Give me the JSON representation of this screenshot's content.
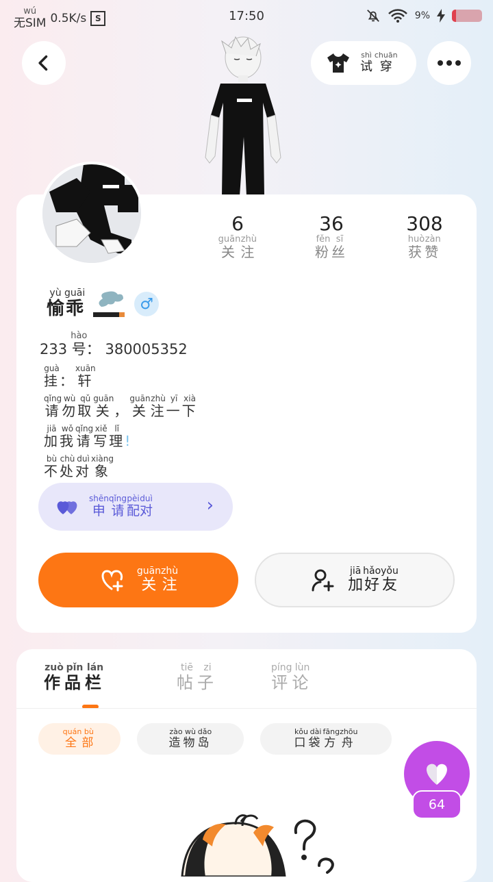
{
  "status_bar": {
    "no_sim": "无SIM",
    "no_sim_ruby": "wú",
    "speed": "0.5K/s",
    "s_badge": "S",
    "time": "17:50",
    "battery": "9%"
  },
  "top": {
    "back_icon": "chevron-left-icon",
    "try_on": {
      "label_1": "试",
      "ruby_1": "shì",
      "label_2": "穿",
      "ruby_2": "chuān",
      "icon": "shirt-sparkle-icon"
    },
    "more_icon": "more-dots-icon"
  },
  "stats": [
    {
      "value": "6",
      "label": [
        "关",
        "注"
      ],
      "ruby": [
        "guān",
        "zhù"
      ]
    },
    {
      "value": "36",
      "label": [
        "粉",
        "丝"
      ],
      "ruby": [
        "fěn",
        "sī"
      ]
    },
    {
      "value": "308",
      "label": [
        "获",
        "赞"
      ],
      "ruby": [
        "huò",
        "zàn"
      ]
    }
  ],
  "profile": {
    "name": [
      "愉",
      "乖"
    ],
    "name_ruby": [
      "yù",
      "guāi"
    ],
    "gender_symbol": "♂",
    "id_prefix": "233",
    "id_hao": "号",
    "id_hao_ruby": "hào",
    "id_sep": "：",
    "id_number": "380005352",
    "bio": [
      {
        "chars": [
          "挂",
          "：",
          "轩"
        ],
        "ruby": [
          "guà",
          "",
          "xuān"
        ]
      },
      {
        "chars": [
          "请",
          "勿",
          "取",
          "关",
          "，",
          "关",
          "注",
          "一",
          "下"
        ],
        "ruby": [
          "qǐng",
          "wù",
          "qǔ",
          "guān",
          "",
          "guān",
          "zhù",
          "yī",
          "xià"
        ]
      },
      {
        "chars": [
          "加",
          "我",
          "请",
          "写",
          "理",
          "!"
        ],
        "ruby": [
          "jiā",
          "wǒ",
          "qǐng",
          "xiě",
          "lǐ",
          ""
        ]
      },
      {
        "chars": [
          "不",
          "处",
          "对",
          "象"
        ],
        "ruby": [
          "bù",
          "chù",
          "duì",
          "xiàng"
        ]
      }
    ]
  },
  "pair_button": {
    "chars": [
      "申",
      "请",
      "配",
      "对"
    ],
    "ruby": [
      "shēn",
      "qǐng",
      "pèi",
      "duì"
    ],
    "chevron": "›"
  },
  "follow_button": {
    "chars": [
      "关",
      "注"
    ],
    "ruby": [
      "guān",
      "zhù"
    ]
  },
  "add_friend_button": {
    "chars": [
      "加",
      "好",
      "友"
    ],
    "ruby": [
      "jiā",
      "hǎo",
      "yǒu"
    ]
  },
  "tabs": [
    {
      "chars": [
        "作",
        "品",
        "栏"
      ],
      "ruby": [
        "zuò",
        "pǐn",
        "lán"
      ],
      "active": true
    },
    {
      "chars": [
        "帖",
        "子"
      ],
      "ruby": [
        "tiē",
        "zi"
      ],
      "active": false
    },
    {
      "chars": [
        "评",
        "论"
      ],
      "ruby": [
        "píng",
        "lùn"
      ],
      "active": false
    }
  ],
  "filters": [
    {
      "chars": [
        "全",
        "部"
      ],
      "ruby": [
        "quán",
        "bù"
      ],
      "selected": true
    },
    {
      "chars": [
        "造",
        "物",
        "岛"
      ],
      "ruby": [
        "zào",
        "wù",
        "dǎo"
      ],
      "selected": false
    },
    {
      "chars": [
        "口",
        "袋",
        "方",
        "舟"
      ],
      "ruby": [
        "kǒu",
        "dài",
        "fāng",
        "zhōu"
      ],
      "selected": false
    }
  ],
  "like": {
    "count": "64",
    "icon": "heart-icon"
  },
  "colors": {
    "accent": "#fd7614",
    "purple": "#c24de6",
    "pair_bg": "#e8e7fa",
    "pair_text": "#5a5ad8"
  }
}
